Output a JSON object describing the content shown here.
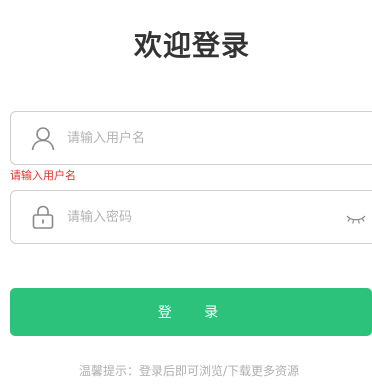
{
  "title": "欢迎登录",
  "username": {
    "placeholder": "请输入用户名",
    "value": "",
    "error": "请输入用户名",
    "icon": "user-icon"
  },
  "password": {
    "placeholder": "请输入密码",
    "value": "",
    "icon": "lock-icon",
    "toggle_icon": "eye-closed-icon"
  },
  "login_button": {
    "label": "登 录",
    "color": "#2dc27b"
  },
  "hint": "温馨提示：登录后即可浏览/下载更多资源",
  "colors": {
    "error": "#e0322b",
    "border": "#cfcfcf",
    "title": "#333333"
  }
}
